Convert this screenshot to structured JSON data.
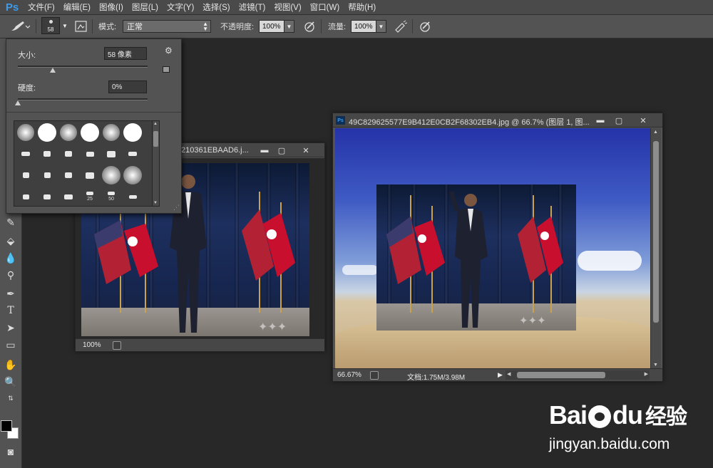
{
  "app": {
    "logo": "Ps",
    "menu": [
      "文件(F)",
      "编辑(E)",
      "图像(I)",
      "图层(L)",
      "文字(Y)",
      "选择(S)",
      "滤镜(T)",
      "视图(V)",
      "窗口(W)",
      "帮助(H)"
    ]
  },
  "options_bar": {
    "brush_size": "58",
    "mode_label": "模式:",
    "mode_value": "正常",
    "opacity_label": "不透明度:",
    "opacity_value": "100%",
    "flow_label": "流量:",
    "flow_value": "100%"
  },
  "brush_panel": {
    "size_label": "大小:",
    "size_value": "58 像素",
    "size_fraction": 0.27,
    "hardness_label": "硬度:",
    "hardness_value": "0%",
    "hardness_fraction": 0.0,
    "brush_numbers": [
      "25",
      "50"
    ]
  },
  "doc_back": {
    "title": "210361EBAAD6.j...",
    "zoom": "100%"
  },
  "doc_front": {
    "title": "49C829625577E9B412E0CB2F68302EB4.jpg @ 66.7% (图层 1, 图...",
    "zoom": "66.67%",
    "doc_info": "文档:1.75M/3.98M"
  },
  "watermark": {
    "logo_text_a": "Bai",
    "logo_text_b": "du",
    "logo_text_c": "经验",
    "url": "jingyan.baidu.com"
  }
}
